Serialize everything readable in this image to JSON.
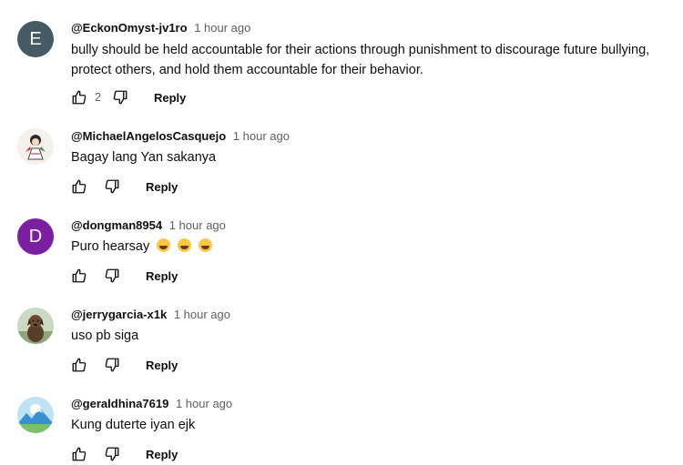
{
  "reply_label": "Reply",
  "comments": [
    {
      "avatar_letter": "E",
      "avatar_color": "#455a64",
      "username": "@EckonOmyst-jv1ro",
      "time": "1 hour ago",
      "text": "bully should be held accountable for their actions through punishment to discourage future bullying, protect others, and hold them accountable for their behavior.",
      "likes": "2"
    },
    {
      "avatar_icon": "anime-figure-avatar-icon",
      "username": "@MichaelAngelosCasquejo",
      "time": "1 hour ago",
      "text": "Bagay lang Yan sakanya"
    },
    {
      "avatar_letter": "D",
      "avatar_color": "#7b1fa2",
      "username": "@dongman8954",
      "time": "1 hour ago",
      "text": "Puro hearsay",
      "emoji": [
        "laughing-emoji",
        "laughing-emoji",
        "laughing-emoji"
      ]
    },
    {
      "avatar_icon": "dog-avatar-icon",
      "username": "@jerrygarcia-x1k",
      "time": "1 hour ago",
      "text": "uso pb siga"
    },
    {
      "avatar_icon": "mountain-landscape-avatar-icon",
      "username": "@geraldhina7619",
      "time": "1 hour ago",
      "text": "Kung duterte iyan ejk"
    }
  ]
}
